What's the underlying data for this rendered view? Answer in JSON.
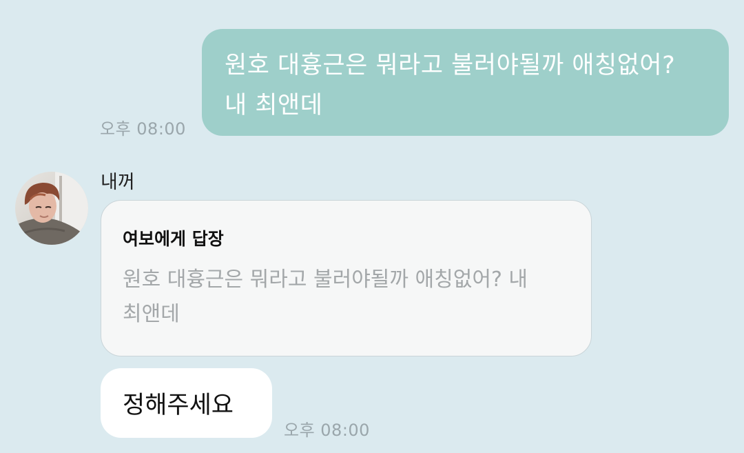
{
  "chat": {
    "outgoing": {
      "text": "원호 대흉근은 뭐라고 불러야될까 애칭없어?\n내 최앤데",
      "time": "오후 08:00"
    },
    "sender": {
      "name": "내꺼",
      "avatar_icon": "profile-photo"
    },
    "reply": {
      "title": "여보에게 답장",
      "quote": "원호 대흉근은 뭐라고 불러야될까 애칭없어? 내\n최앤데"
    },
    "incoming": {
      "text": "정해주세요",
      "time": "오후 08:00"
    }
  },
  "colors": {
    "background": "#dbeaef",
    "outgoing_bubble": "#9ecfca",
    "incoming_bubble": "#ffffff",
    "reply_card": "#f6f7f7",
    "timestamp": "#9aa6ab"
  }
}
